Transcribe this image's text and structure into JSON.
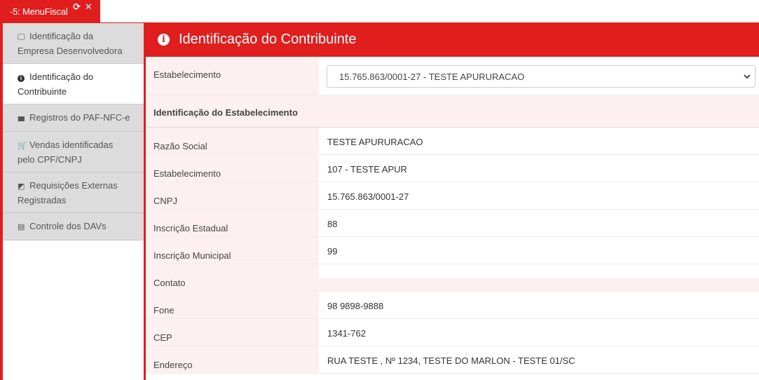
{
  "tab": {
    "label": "-5: MenuFiscal",
    "refresh_glyph": "⟳",
    "close_glyph": "✕"
  },
  "sidebar": {
    "items": [
      {
        "icon": "monitor-icon",
        "glyph": "🖵",
        "label_line1": "Identificação da",
        "label_line2": "Empresa Desenvolvedora"
      },
      {
        "icon": "info-icon",
        "glyph": "i",
        "label_line1": "Identificação do",
        "label_line2": "Contribuinte"
      },
      {
        "icon": "barcode-icon",
        "glyph": "▮▮▮",
        "label_line1": "Registros do PAF-NFC-e"
      },
      {
        "icon": "cart-icon",
        "glyph": "🛒",
        "label_line1": "Vendas identificadas",
        "label_line2": "pelo CPF/CNPJ"
      },
      {
        "icon": "external-link-icon",
        "glyph": "◩",
        "label_line1": "Requisições Externas",
        "label_line2": "Registradas"
      },
      {
        "icon": "file-icon",
        "glyph": "▤",
        "label_line1": "Controle dos DAVs"
      }
    ]
  },
  "header": {
    "title": "Identificação do Contribuinte",
    "info_glyph": "i"
  },
  "form": {
    "establishment_label": "Estabelecimento",
    "establishment_value": "15.765.863/0001-27 - TESTE APURURACAO",
    "section_title": "Identificação do Estabelecimento",
    "fields": [
      {
        "label": "Razão Social",
        "value": "TESTE APURURACAO"
      },
      {
        "label": "Estabelecimento",
        "value": "107 - TESTE APUR"
      },
      {
        "label": "CNPJ",
        "value": "15.765.863/0001-27"
      },
      {
        "label": "Inscrição Estadual",
        "value": "88"
      },
      {
        "label": "Inscrição Municipal",
        "value": "99"
      },
      {
        "label": "Contato",
        "value": ""
      },
      {
        "label": "Fone",
        "value": "98 9898-9888"
      },
      {
        "label": "CEP",
        "value": "1341-762"
      },
      {
        "label": "Endereço",
        "value": "RUA TESTE , Nº 1234, TESTE DO MARLON - TESTE 01/SC"
      }
    ]
  },
  "colors": {
    "accent": "#e01e1e",
    "label_bg": "#fdf0f0",
    "sidebar_bg": "#dcdcdc"
  }
}
